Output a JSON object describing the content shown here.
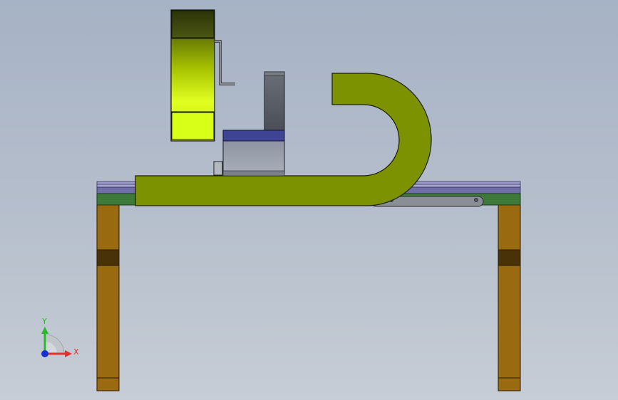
{
  "viewport": {
    "background_top": "#a6b2c5",
    "background_bottom": "#c6cdd6"
  },
  "model": {
    "frame": {
      "leg_color": "#9a6a10",
      "leg_band_color": "#4a3208",
      "rail_green": "#3e7a3a",
      "rail_blue": "#6f6ea8",
      "rail_lavender": "#9c9ccc"
    },
    "cable_carrier_color": "#7d9200",
    "hopper": {
      "top_color": "#3a4410",
      "body_color": "#c4e400",
      "bottom_color": "#d7ff18"
    },
    "machine_head": {
      "column_color": "#5c6068",
      "cap_color": "#3e4492",
      "body_color": "#9aa0ac"
    }
  },
  "triad": {
    "y_axis_label": "Y",
    "x_axis_label": "X",
    "y_color": "#2cb82c",
    "x_color": "#e23030",
    "z_color": "#1830d0"
  }
}
